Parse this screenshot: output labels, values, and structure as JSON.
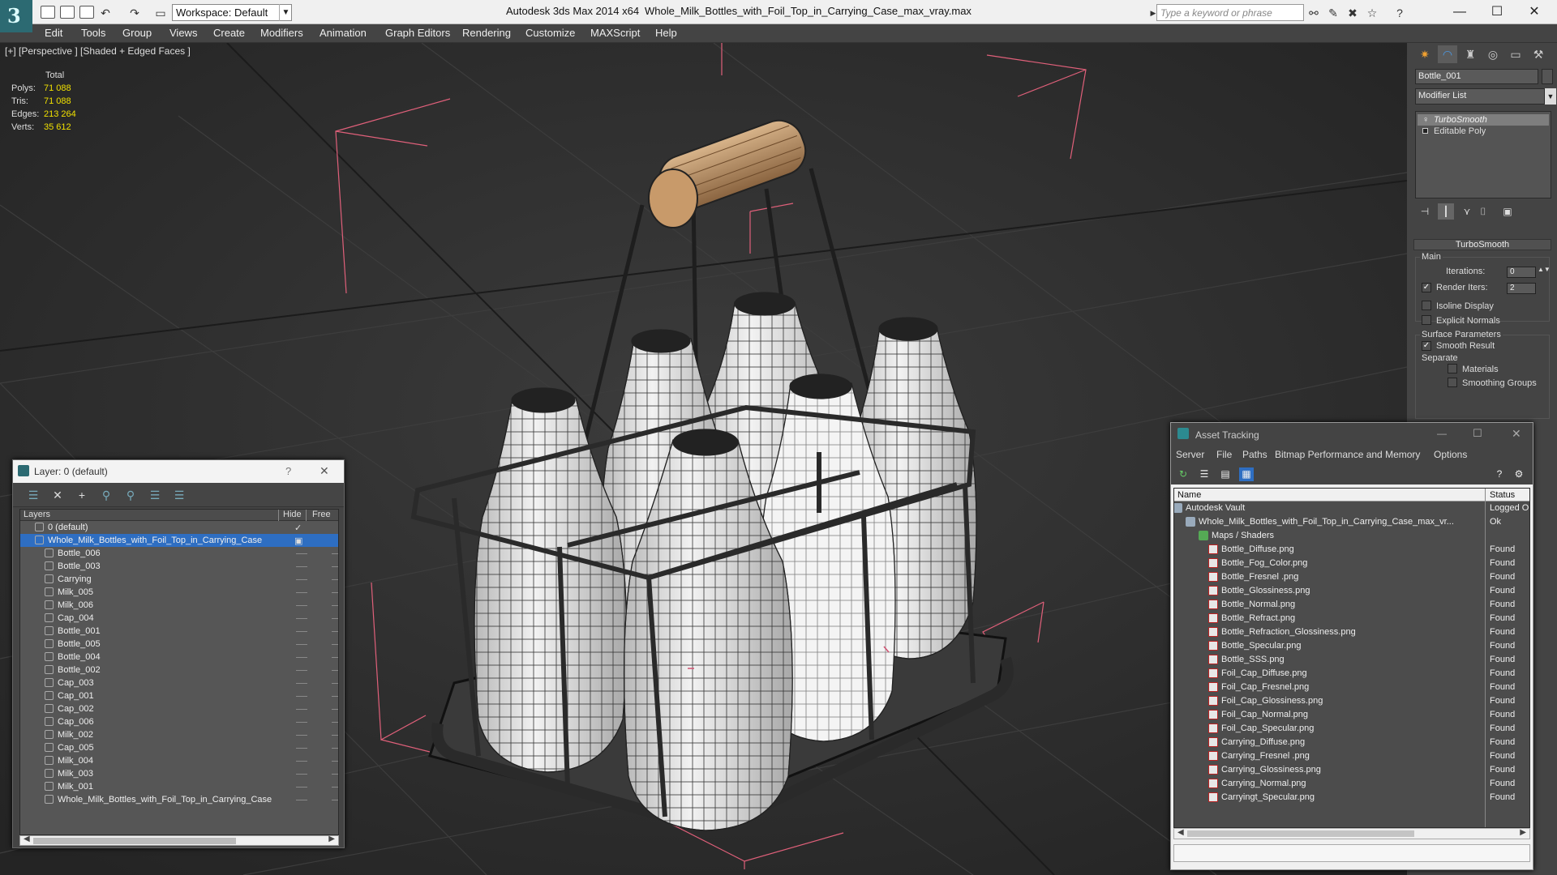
{
  "titlebar": {
    "workspace_label": "Workspace: Default",
    "app_title": "Autodesk 3ds Max  2014 x64",
    "file_title": "Whole_Milk_Bottles_with_Foil_Top_in_Carrying_Case_max_vray.max",
    "search_placeholder": "Type a keyword or phrase"
  },
  "menubar": [
    "Edit",
    "Tools",
    "Group",
    "Views",
    "Create",
    "Modifiers",
    "Animation",
    "Graph Editors",
    "Rendering",
    "Customize",
    "MAXScript",
    "Help"
  ],
  "viewport": {
    "label": "[+] [Perspective ] [Shaded + Edged Faces ]",
    "stats": {
      "header": "Total",
      "rows": [
        {
          "label": "Polys:",
          "value": "71 088"
        },
        {
          "label": "Tris:",
          "value": "71 088"
        },
        {
          "label": "Edges:",
          "value": "213 264"
        },
        {
          "label": "Verts:",
          "value": "35 612"
        }
      ]
    }
  },
  "command_panel": {
    "object_name": "Bottle_001",
    "modifier_list": "Modifier List",
    "stack": [
      "TurboSmooth",
      "Editable Poly"
    ],
    "rollout_title": "TurboSmooth",
    "main_label": "Main",
    "iterations_label": "Iterations:",
    "iterations_value": "0",
    "render_iters_label": "Render Iters:",
    "render_iters_value": "2",
    "isoline_label": "Isoline Display",
    "explicit_normals_label": "Explicit Normals",
    "surface_params_label": "Surface Parameters",
    "smooth_result_label": "Smooth Result",
    "separate_label": "Separate",
    "materials_label": "Materials",
    "smoothing_groups_label": "Smoothing Groups"
  },
  "layer_dialog": {
    "title": "Layer: 0 (default)",
    "col_layers": "Layers",
    "col_hide": "Hide",
    "col_freeze": "Free",
    "rows": [
      {
        "name": "0 (default)",
        "level": 0,
        "type": "layer"
      },
      {
        "name": "Whole_Milk_Bottles_with_Foil_Top_in_Carrying_Case",
        "level": 0,
        "type": "layer",
        "selected": true
      },
      {
        "name": "Bottle_006",
        "level": 1,
        "type": "object"
      },
      {
        "name": "Bottle_003",
        "level": 1,
        "type": "object"
      },
      {
        "name": "Carrying",
        "level": 1,
        "type": "object"
      },
      {
        "name": "Milk_005",
        "level": 1,
        "type": "object"
      },
      {
        "name": "Milk_006",
        "level": 1,
        "type": "object"
      },
      {
        "name": "Cap_004",
        "level": 1,
        "type": "object"
      },
      {
        "name": "Bottle_001",
        "level": 1,
        "type": "object"
      },
      {
        "name": "Bottle_005",
        "level": 1,
        "type": "object"
      },
      {
        "name": "Bottle_004",
        "level": 1,
        "type": "object"
      },
      {
        "name": "Bottle_002",
        "level": 1,
        "type": "object"
      },
      {
        "name": "Cap_003",
        "level": 1,
        "type": "object"
      },
      {
        "name": "Cap_001",
        "level": 1,
        "type": "object"
      },
      {
        "name": "Cap_002",
        "level": 1,
        "type": "object"
      },
      {
        "name": "Cap_006",
        "level": 1,
        "type": "object"
      },
      {
        "name": "Milk_002",
        "level": 1,
        "type": "object"
      },
      {
        "name": "Cap_005",
        "level": 1,
        "type": "object"
      },
      {
        "name": "Milk_004",
        "level": 1,
        "type": "object"
      },
      {
        "name": "Milk_003",
        "level": 1,
        "type": "object"
      },
      {
        "name": "Milk_001",
        "level": 1,
        "type": "object"
      },
      {
        "name": "Whole_Milk_Bottles_with_Foil_Top_in_Carrying_Case",
        "level": 1,
        "type": "object"
      }
    ]
  },
  "asset_tracking": {
    "title": "Asset Tracking",
    "menu": [
      "Server",
      "File",
      "Paths",
      "Bitmap Performance and Memory",
      "Options"
    ],
    "col_name": "Name",
    "col_status": "Status",
    "rows": [
      {
        "name": "Autodesk Vault",
        "status": "Logged O",
        "level": 0
      },
      {
        "name": "Whole_Milk_Bottles_with_Foil_Top_in_Carrying_Case_max_vr...",
        "status": "Ok",
        "level": 1
      },
      {
        "name": "Maps / Shaders",
        "status": "",
        "level": 2
      },
      {
        "name": "Bottle_Diffuse.png",
        "status": "Found",
        "level": 3
      },
      {
        "name": "Bottle_Fog_Color.png",
        "status": "Found",
        "level": 3
      },
      {
        "name": "Bottle_Fresnel .png",
        "status": "Found",
        "level": 3
      },
      {
        "name": "Bottle_Glossiness.png",
        "status": "Found",
        "level": 3
      },
      {
        "name": "Bottle_Normal.png",
        "status": "Found",
        "level": 3
      },
      {
        "name": "Bottle_Refract.png",
        "status": "Found",
        "level": 3
      },
      {
        "name": "Bottle_Refraction_Glossiness.png",
        "status": "Found",
        "level": 3
      },
      {
        "name": "Bottle_Specular.png",
        "status": "Found",
        "level": 3
      },
      {
        "name": "Bottle_SSS.png",
        "status": "Found",
        "level": 3
      },
      {
        "name": "Foil_Cap_Diffuse.png",
        "status": "Found",
        "level": 3
      },
      {
        "name": "Foil_Cap_Fresnel.png",
        "status": "Found",
        "level": 3
      },
      {
        "name": "Foil_Cap_Glossiness.png",
        "status": "Found",
        "level": 3
      },
      {
        "name": "Foil_Cap_Normal.png",
        "status": "Found",
        "level": 3
      },
      {
        "name": "Foil_Cap_Specular.png",
        "status": "Found",
        "level": 3
      },
      {
        "name": "Carrying_Diffuse.png",
        "status": "Found",
        "level": 3
      },
      {
        "name": "Carrying_Fresnel .png",
        "status": "Found",
        "level": 3
      },
      {
        "name": "Carrying_Glossiness.png",
        "status": "Found",
        "level": 3
      },
      {
        "name": "Carrying_Normal.png",
        "status": "Found",
        "level": 3
      },
      {
        "name": "Carryingt_Specular.png",
        "status": "Found",
        "level": 3
      }
    ]
  },
  "colors": {
    "selection": "#2e6ec2",
    "stats_value": "#f0e000",
    "bounding_box": "#e0607a",
    "viewport_bg": "#2e2e2e"
  }
}
